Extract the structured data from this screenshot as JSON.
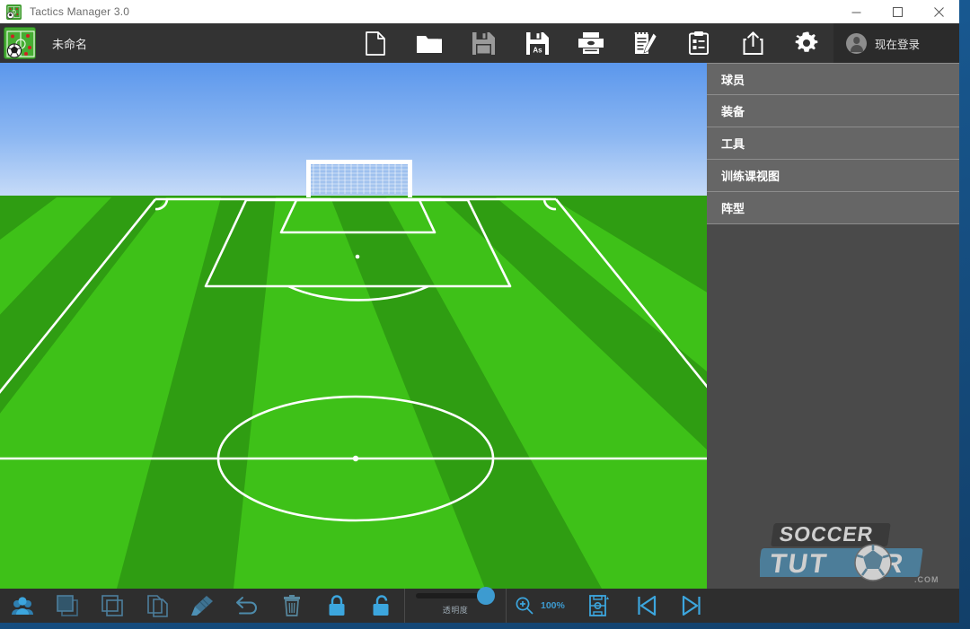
{
  "window": {
    "title": "Tactics Manager 3.0",
    "app_icon": "tactics-board-icon",
    "controls": {
      "minimize": "minimize-button",
      "maximize": "maximize-button",
      "close": "close-button"
    }
  },
  "toolbar": {
    "document_name": "未命名",
    "buttons": [
      {
        "name": "new-file-button",
        "icon": "new-file-icon",
        "label": "新建"
      },
      {
        "name": "open-file-button",
        "icon": "open-folder-icon",
        "label": "打开"
      },
      {
        "name": "save-button",
        "icon": "save-disk-icon",
        "label": "保存"
      },
      {
        "name": "save-as-button",
        "icon": "save-as-icon",
        "label": "另存为",
        "badge": "As"
      },
      {
        "name": "print-button",
        "icon": "printer-icon",
        "label": "打印"
      },
      {
        "name": "edit-notes-button",
        "icon": "notepad-pencil-icon",
        "label": "编辑"
      },
      {
        "name": "session-plan-button",
        "icon": "clipboard-icon",
        "label": "课程计划"
      },
      {
        "name": "export-share-button",
        "icon": "share-export-icon",
        "label": "导出"
      },
      {
        "name": "settings-button",
        "icon": "gear-icon",
        "label": "设置"
      }
    ],
    "login": {
      "label": "现在登录",
      "avatar": "user-avatar-icon"
    }
  },
  "sidebar": {
    "items": [
      {
        "label": "球员",
        "name": "sidebar-item-players"
      },
      {
        "label": "装备",
        "name": "sidebar-item-equipment"
      },
      {
        "label": "工具",
        "name": "sidebar-item-tools"
      },
      {
        "label": "训练课视图",
        "name": "sidebar-item-session-view"
      },
      {
        "label": "阵型",
        "name": "sidebar-item-formation"
      }
    ]
  },
  "watermark": {
    "word_top": "SOCCER",
    "word_bottom_left": "TUT",
    "word_bottom_right": "R",
    "domain": ".COM"
  },
  "bottombar": {
    "buttons": [
      {
        "name": "select-players-button",
        "icon": "group-people-icon"
      },
      {
        "name": "bring-forward-button",
        "icon": "layers-front-icon"
      },
      {
        "name": "send-backward-button",
        "icon": "layers-back-icon"
      },
      {
        "name": "duplicate-button",
        "icon": "copy-pages-icon"
      },
      {
        "name": "clear-board-button",
        "icon": "brush-icon"
      },
      {
        "name": "undo-button",
        "icon": "undo-arrow-icon"
      },
      {
        "name": "delete-button",
        "icon": "trash-icon"
      },
      {
        "name": "lock-button",
        "icon": "lock-closed-icon"
      },
      {
        "name": "unlock-button",
        "icon": "lock-open-icon"
      }
    ],
    "opacity_slider": {
      "label": "透明度",
      "value": 78
    },
    "zoom": {
      "icon": "zoom-in-icon",
      "value": "100%"
    },
    "pitch_view_selector": {
      "icon": "pitch-view-icon"
    },
    "prev_frame": {
      "icon": "skip-previous-icon"
    },
    "next_frame": {
      "icon": "skip-next-icon"
    }
  },
  "pitch": {
    "view": "perspective-half-pitch",
    "colors": {
      "sky_top": "#6fa4ef",
      "sky_bottom": "#cfe0f7",
      "grass_light": "#3ec118",
      "grass_dark": "#2f9d12",
      "line": "#ffffff"
    },
    "markings": [
      "goal",
      "goal-net",
      "penalty-area",
      "six-yard-box",
      "penalty-spot",
      "penalty-arc",
      "corner-arcs",
      "halfway-line",
      "centre-circle",
      "centre-spot"
    ]
  }
}
